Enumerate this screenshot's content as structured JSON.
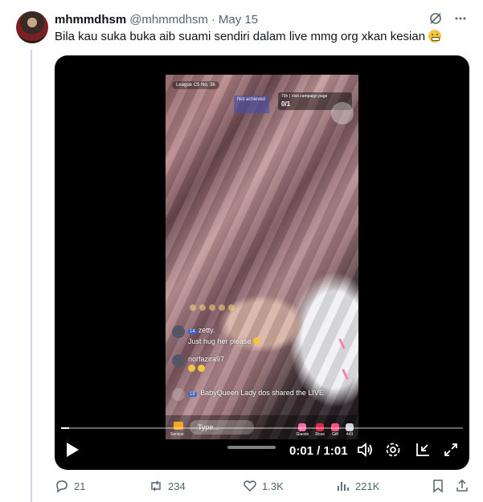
{
  "tweet": {
    "display_name": "mhmmdhsm",
    "handle": "@mhmmdhsm",
    "separator": "·",
    "date": "May 15",
    "text": "Bila kau suka buka aib suami sendiri dalam live mmg org xkan kesian",
    "emoji_icon": "grimacing-face-icon"
  },
  "video_overlay": {
    "league_label": "League C5 No. 36",
    "status_pill": "Not achieved",
    "campaign_header": "70h | Visit campaign page",
    "campaign_count": "0/1",
    "comments": [
      {
        "badge": "14",
        "user": "zetty.",
        "text": "Just hug her please"
      },
      {
        "badge": "",
        "user": "norfazira97",
        "text": ""
      },
      {
        "badge": "18",
        "user": "BabyQueen",
        "text": "Lady dos shared the LIVE"
      }
    ],
    "input_placeholder": "Type...",
    "service_label": "Service",
    "bottom_actions": [
      "Guests",
      "Rose",
      "Gift",
      "443"
    ]
  },
  "player": {
    "time_display": "0:01 / 1:01",
    "progress_fraction": 0.02
  },
  "actions": {
    "replies": "21",
    "reposts": "234",
    "likes": "1.3K",
    "views": "221K"
  }
}
